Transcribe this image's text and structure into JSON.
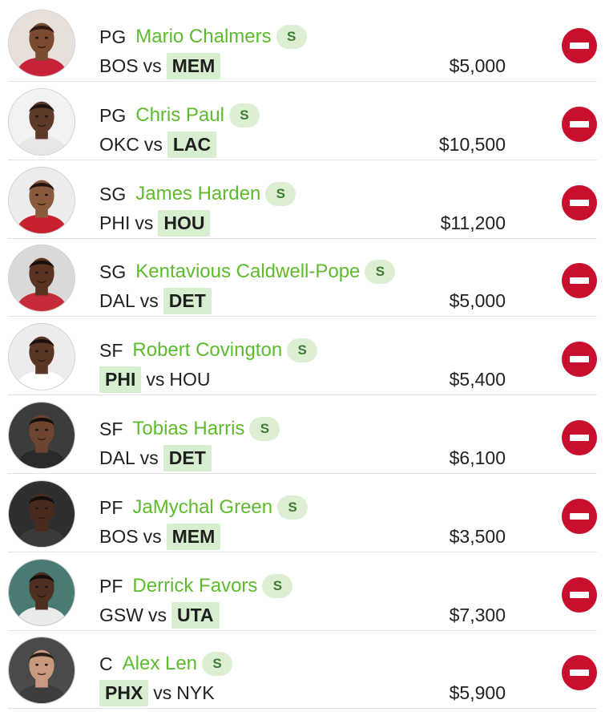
{
  "colors": {
    "name_green": "#5dbb2d",
    "badge_bg": "#dcefd3",
    "badge_text": "#3f7a34",
    "team_highlight": "#d8eed0",
    "remove_red": "#c8102e",
    "divider": "#e2e2e2"
  },
  "icons": {
    "remove": "minus-circle-icon",
    "avatar": "player-headshot"
  },
  "players": [
    {
      "position": "PG",
      "name": "Mario Chalmers",
      "badge": "S",
      "away": "BOS",
      "vs": "vs",
      "home": "MEM",
      "highlight": "home",
      "salary": "$5,000",
      "skin": "#7a4a31",
      "bg": "#e9dfd9",
      "jersey": "#c8223a",
      "hair": "#2a1a12"
    },
    {
      "position": "PG",
      "name": "Chris Paul",
      "badge": "S",
      "away": "OKC",
      "vs": "vs",
      "home": "LAC",
      "highlight": "home",
      "salary": "$10,500",
      "skin": "#5c3a27",
      "bg": "#f2f2f2",
      "jersey": "#e7e7e7",
      "hair": "#1d1410"
    },
    {
      "position": "SG",
      "name": "James Harden",
      "badge": "S",
      "away": "PHI",
      "vs": "vs",
      "home": "HOU",
      "highlight": "home",
      "salary": "$11,200",
      "skin": "#8a5a3c",
      "bg": "#ececec",
      "jersey": "#c9202f",
      "hair": "#231611"
    },
    {
      "position": "SG",
      "name": "Kentavious Caldwell-Pope",
      "badge": "S",
      "away": "DAL",
      "vs": "vs",
      "home": "DET",
      "highlight": "home",
      "salary": "$5,000",
      "skin": "#5a3322",
      "bg": "#d9d9d9",
      "jersey": "#c52c38",
      "hair": "#1b110c"
    },
    {
      "position": "SF",
      "name": "Robert Covington",
      "badge": "S",
      "away": "PHI",
      "vs": "vs",
      "home": "HOU",
      "highlight": "away",
      "salary": "$5,400",
      "skin": "#5a3626",
      "bg": "#ececec",
      "jersey": "#ffffff",
      "hair": "#1a100c"
    },
    {
      "position": "SF",
      "name": "Tobias Harris",
      "badge": "S",
      "away": "DAL",
      "vs": "vs",
      "home": "DET",
      "highlight": "home",
      "salary": "$6,100",
      "skin": "#6e4330",
      "bg": "#3c3c3c",
      "jersey": "#2a2a2a",
      "hair": "#140c08"
    },
    {
      "position": "PF",
      "name": "JaMychal Green",
      "badge": "S",
      "away": "BOS",
      "vs": "vs",
      "home": "MEM",
      "highlight": "home",
      "salary": "$3,500",
      "skin": "#4a2c1e",
      "bg": "#2f2f2f",
      "jersey": "#3a3a3a",
      "hair": "#120b08"
    },
    {
      "position": "PF",
      "name": "Derrick Favors",
      "badge": "S",
      "away": "GSW",
      "vs": "vs",
      "home": "UTA",
      "highlight": "home",
      "salary": "$7,300",
      "skin": "#4e3022",
      "bg": "#4a7a74",
      "jersey": "#eaeaea",
      "hair": "#150d09"
    },
    {
      "position": "C",
      "name": "Alex Len",
      "badge": "S",
      "away": "PHX",
      "vs": "vs",
      "home": "NYK",
      "highlight": "away",
      "salary": "$5,900",
      "skin": "#c99a7e",
      "bg": "#4a4a4a",
      "jersey": "#3d3d3d",
      "hair": "#2a1e18"
    }
  ]
}
